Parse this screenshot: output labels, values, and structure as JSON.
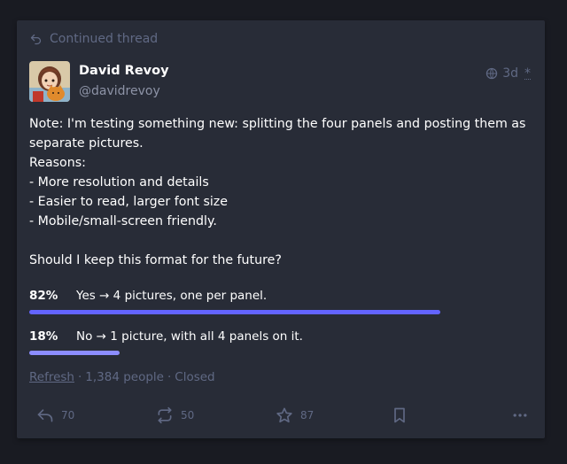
{
  "prepend": {
    "label": "Continued thread",
    "icon": "reply-icon"
  },
  "author": {
    "display_name": "David Revoy",
    "acct": "@davidrevoy"
  },
  "meta": {
    "visibility_icon": "globe-icon",
    "time": "3d",
    "edited_marker": "*"
  },
  "content": "Note: I'm testing something new: splitting the four panels and posting them as separate pictures.\nReasons:\n- More resolution and details\n- Easier to read, larger font size\n- Mobile/small-screen friendly.\n\nShould I keep this format for the future?",
  "poll": {
    "options": [
      {
        "percent_label": "82%",
        "percent": 82,
        "text": "Yes → 4 pictures, one per panel.",
        "leading": true
      },
      {
        "percent_label": "18%",
        "percent": 18,
        "text": "No → 1 picture, with all 4 panels on it.",
        "leading": false
      }
    ],
    "footer": {
      "refresh": "Refresh",
      "sep1": "·",
      "people": "1,384 people",
      "sep2": "·",
      "status": "Closed"
    }
  },
  "actions": {
    "reply_count": "70",
    "boost_count": "50",
    "favourite_count": "87"
  },
  "colors": {
    "leading_bar": "#6364ff",
    "other_bar": "#8c8dff",
    "background": "#191b22",
    "card": "#282c37"
  }
}
